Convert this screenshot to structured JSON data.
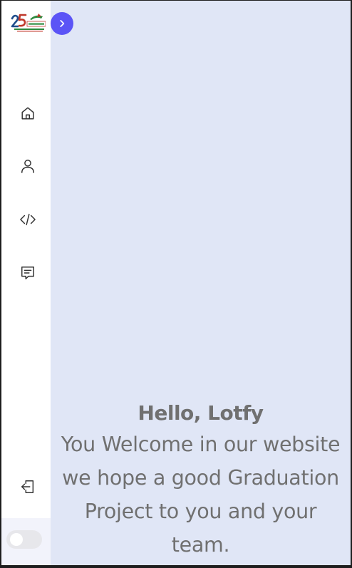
{
  "app": {
    "logo_icon": "future-25-logo",
    "accent_color": "#5b54f6",
    "background_color": "#e0e6f6"
  },
  "sidebar": {
    "items": [
      {
        "icon": "home-icon",
        "label": "Home"
      },
      {
        "icon": "user-icon",
        "label": "Profile"
      },
      {
        "icon": "code-icon",
        "label": "Projects"
      },
      {
        "icon": "message-icon",
        "label": "Messages"
      }
    ],
    "logout_icon": "logout-icon",
    "theme_toggle": {
      "state": "off"
    }
  },
  "expand_icon": "chevron-right-icon",
  "hero": {
    "greeting": "Hello, Lotfy",
    "message": "You Welcome in our website we hope a good Graduation Project to you and your team."
  }
}
